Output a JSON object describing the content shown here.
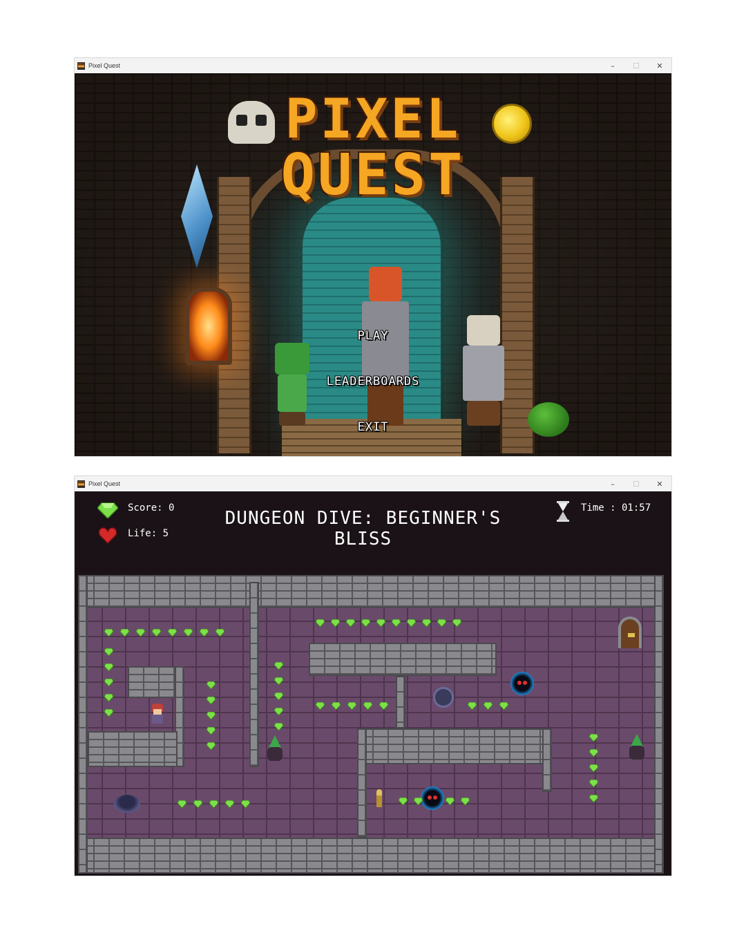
{
  "window": {
    "title": "Pixel Quest",
    "controls": {
      "minimize": "–",
      "maximize": "☐",
      "close": "✕"
    }
  },
  "title_screen": {
    "logo_line1": "PIXEL",
    "logo_line2": "QUEST",
    "menu": {
      "play": "PLAY",
      "leaderboards": "LEADERBOARDS",
      "exit": "EXIT"
    }
  },
  "gameplay": {
    "hud": {
      "score": "Score: 0",
      "life": "Life: 5",
      "time": "Time : 01:57",
      "level_title": "DUNGEON DIVE: BEGINNER'S BLISS",
      "icons": {
        "score": "green-gem-icon",
        "life": "red-heart-icon",
        "time": "hourglass-icon"
      }
    },
    "colors": {
      "gem": "#7de04a",
      "heart": "#d42a2a",
      "floor": "#6a4a6a",
      "wall": "#8a8a8e",
      "hud_background": "#1a1216"
    }
  }
}
